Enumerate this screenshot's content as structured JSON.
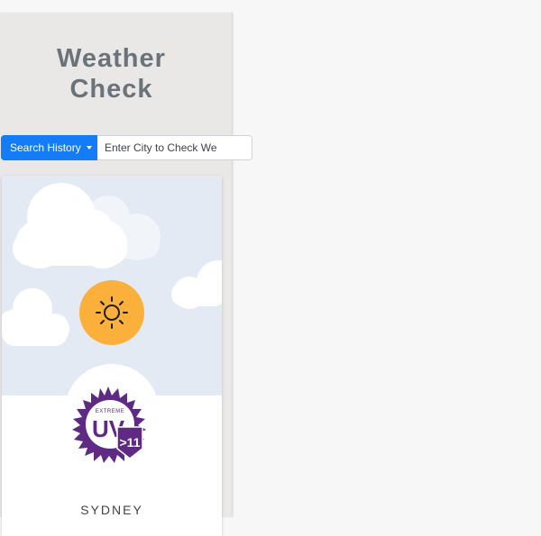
{
  "app": {
    "title_line1": "Weather",
    "title_line2": "Check"
  },
  "search": {
    "history_label": "Search History",
    "input_placeholder": "Enter City to Check Weather",
    "input_visible_text": "Enter City to Check We"
  },
  "weather_card": {
    "condition_icon": "sun-icon",
    "uv_badge": {
      "top_text": "EXTREME",
      "main_text": "UV",
      "index_text": ">11"
    },
    "city": "SYDNEY"
  },
  "colors": {
    "accent_blue": "#137cf6",
    "sun_orange": "#fbb03b",
    "uv_purple": "#5e2a84",
    "sky": "#e4eaf3"
  }
}
